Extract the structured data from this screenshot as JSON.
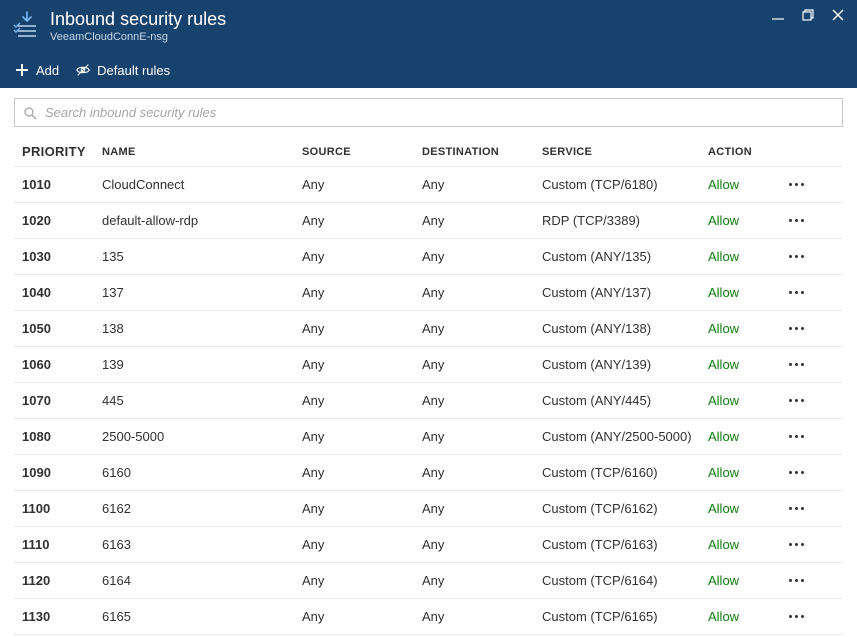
{
  "blade": {
    "title": "Inbound security rules",
    "subtitle": "VeeamCloudConnE-nsg"
  },
  "toolbar": {
    "add_label": "Add",
    "default_rules_label": "Default rules"
  },
  "search": {
    "placeholder": "Search inbound security rules"
  },
  "columns": {
    "priority": "PRIORITY",
    "name": "NAME",
    "source": "SOURCE",
    "destination": "DESTINATION",
    "service": "SERVICE",
    "action": "ACTION"
  },
  "rules": [
    {
      "priority": "1010",
      "name": "CloudConnect",
      "source": "Any",
      "destination": "Any",
      "service": "Custom (TCP/6180)",
      "action": "Allow"
    },
    {
      "priority": "1020",
      "name": "default-allow-rdp",
      "source": "Any",
      "destination": "Any",
      "service": "RDP (TCP/3389)",
      "action": "Allow"
    },
    {
      "priority": "1030",
      "name": "135",
      "source": "Any",
      "destination": "Any",
      "service": "Custom (ANY/135)",
      "action": "Allow"
    },
    {
      "priority": "1040",
      "name": "137",
      "source": "Any",
      "destination": "Any",
      "service": "Custom (ANY/137)",
      "action": "Allow"
    },
    {
      "priority": "1050",
      "name": "138",
      "source": "Any",
      "destination": "Any",
      "service": "Custom (ANY/138)",
      "action": "Allow"
    },
    {
      "priority": "1060",
      "name": "139",
      "source": "Any",
      "destination": "Any",
      "service": "Custom (ANY/139)",
      "action": "Allow"
    },
    {
      "priority": "1070",
      "name": "445",
      "source": "Any",
      "destination": "Any",
      "service": "Custom (ANY/445)",
      "action": "Allow"
    },
    {
      "priority": "1080",
      "name": "2500-5000",
      "source": "Any",
      "destination": "Any",
      "service": "Custom (ANY/2500-5000)",
      "action": "Allow"
    },
    {
      "priority": "1090",
      "name": "6160",
      "source": "Any",
      "destination": "Any",
      "service": "Custom (TCP/6160)",
      "action": "Allow"
    },
    {
      "priority": "1100",
      "name": "6162",
      "source": "Any",
      "destination": "Any",
      "service": "Custom (TCP/6162)",
      "action": "Allow"
    },
    {
      "priority": "1110",
      "name": "6163",
      "source": "Any",
      "destination": "Any",
      "service": "Custom (TCP/6163)",
      "action": "Allow"
    },
    {
      "priority": "1120",
      "name": "6164",
      "source": "Any",
      "destination": "Any",
      "service": "Custom (TCP/6164)",
      "action": "Allow"
    },
    {
      "priority": "1130",
      "name": "6165",
      "source": "Any",
      "destination": "Any",
      "service": "Custom (TCP/6165)",
      "action": "Allow"
    }
  ]
}
